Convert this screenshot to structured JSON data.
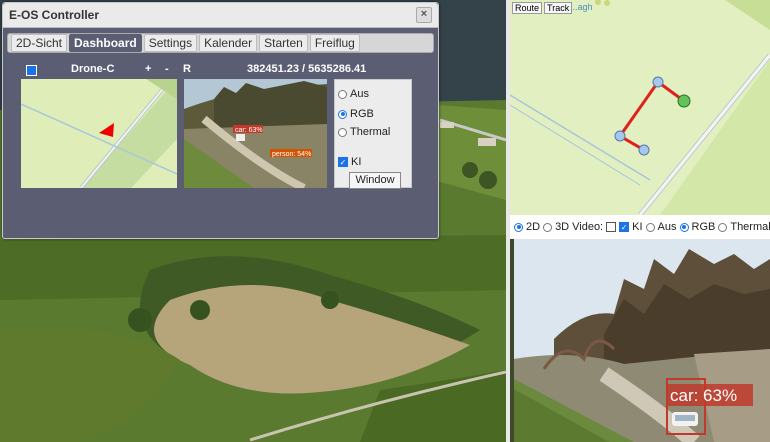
{
  "window": {
    "title": "E-OS Controller",
    "close_icon": "close-icon"
  },
  "tabs": [
    {
      "label": "2D-Sicht",
      "active": false
    },
    {
      "label": "Dashboard",
      "active": true
    },
    {
      "label": "Settings",
      "active": false
    },
    {
      "label": "Kalender",
      "active": false
    },
    {
      "label": "Starten",
      "active": false
    },
    {
      "label": "Freiflug",
      "active": false
    }
  ],
  "drone": {
    "name": "Drone-C",
    "checked": true,
    "plus_label": "+",
    "minus_label": "-",
    "r_label": "R",
    "coordinates": "382451.23 / 5635286.41"
  },
  "mini_camera": {
    "detections": [
      {
        "label": "car: 63%"
      },
      {
        "label": "person: 54%"
      }
    ]
  },
  "mode_options": {
    "items": [
      {
        "label": "Aus",
        "selected": false
      },
      {
        "label": "RGB",
        "selected": true
      },
      {
        "label": "Thermal",
        "selected": false
      }
    ],
    "ki_label": "KI",
    "ki_checked": true,
    "window_button": "Window"
  },
  "map2d": {
    "route_button": "Route",
    "track_button": "Track",
    "map_label": "...agh"
  },
  "view_controls": {
    "view_2d": "2D",
    "view_2d_selected": true,
    "view_3d": "3D",
    "video_label": "Video:",
    "video_checked": false,
    "ki_label": "KI",
    "ki_checked": true,
    "aus_label": "Aus",
    "rgb_label": "RGB",
    "rgb_selected": true,
    "thermal_label": "Thermal"
  },
  "big_camera": {
    "detection_label": "car: 63%"
  },
  "colors": {
    "accent": "#1a73e8",
    "window_bg": "#5b5d73",
    "route_line": "#e0201c",
    "detection_box": "#c0392b",
    "map_green": "#e2efc0"
  }
}
